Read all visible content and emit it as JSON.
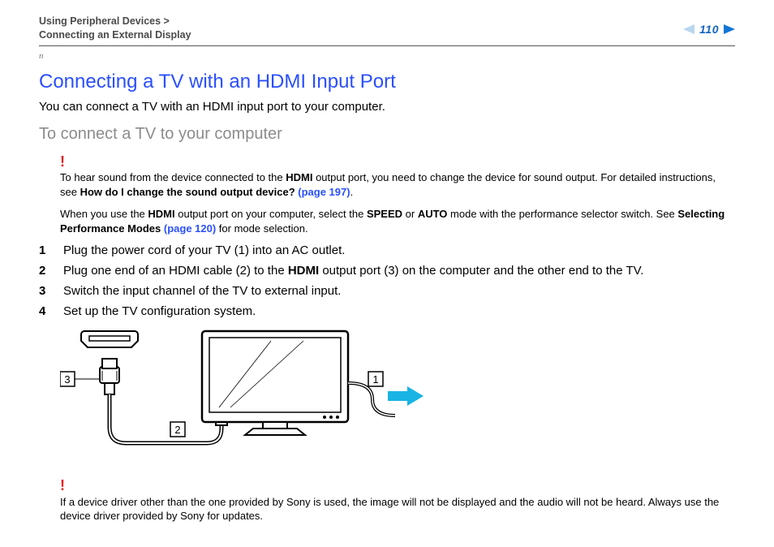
{
  "header": {
    "breadcrumb_line1": "Using Peripheral Devices >",
    "breadcrumb_line2": "Connecting an External Display",
    "page_number": "110",
    "n_marker": "n"
  },
  "title": "Connecting a TV with an HDMI Input Port",
  "intro": "You can connect a TV with an HDMI input port to your computer.",
  "subtitle": "To connect a TV to your computer",
  "note1": {
    "pre": "To hear sound from the device connected to the ",
    "b1": "HDMI",
    "mid1": " output port, you need to change the device for sound output. For detailed instructions, see ",
    "b2": "How do I change the sound output device? ",
    "link": "(page 197)",
    "post": "."
  },
  "note2": {
    "pre": "When you use the ",
    "b1": "HDMI",
    "mid1": " output port on your computer, select the ",
    "b2": "SPEED",
    "mid2": " or ",
    "b3": "AUTO",
    "mid3": " mode with the performance selector switch. See ",
    "b4": "Selecting Performance Modes ",
    "link": "(page 120)",
    "post": " for mode selection."
  },
  "steps": [
    {
      "num": "1",
      "text": "Plug the power cord of your TV (1) into an AC outlet."
    },
    {
      "num": "2",
      "pre": "Plug one end of an HDMI cable (2) to the ",
      "b": "HDMI",
      "post": " output port (3) on the computer and the other end to the TV."
    },
    {
      "num": "3",
      "text": "Switch the input channel of the TV to external input."
    },
    {
      "num": "4",
      "text": "Set up the TV configuration system."
    }
  ],
  "figure": {
    "label1": "1",
    "label2": "2",
    "label3": "3"
  },
  "note3": "If a device driver other than the one provided by Sony is used, the image will not be displayed and the audio will not be heard. Always use the device driver provided by Sony for updates."
}
